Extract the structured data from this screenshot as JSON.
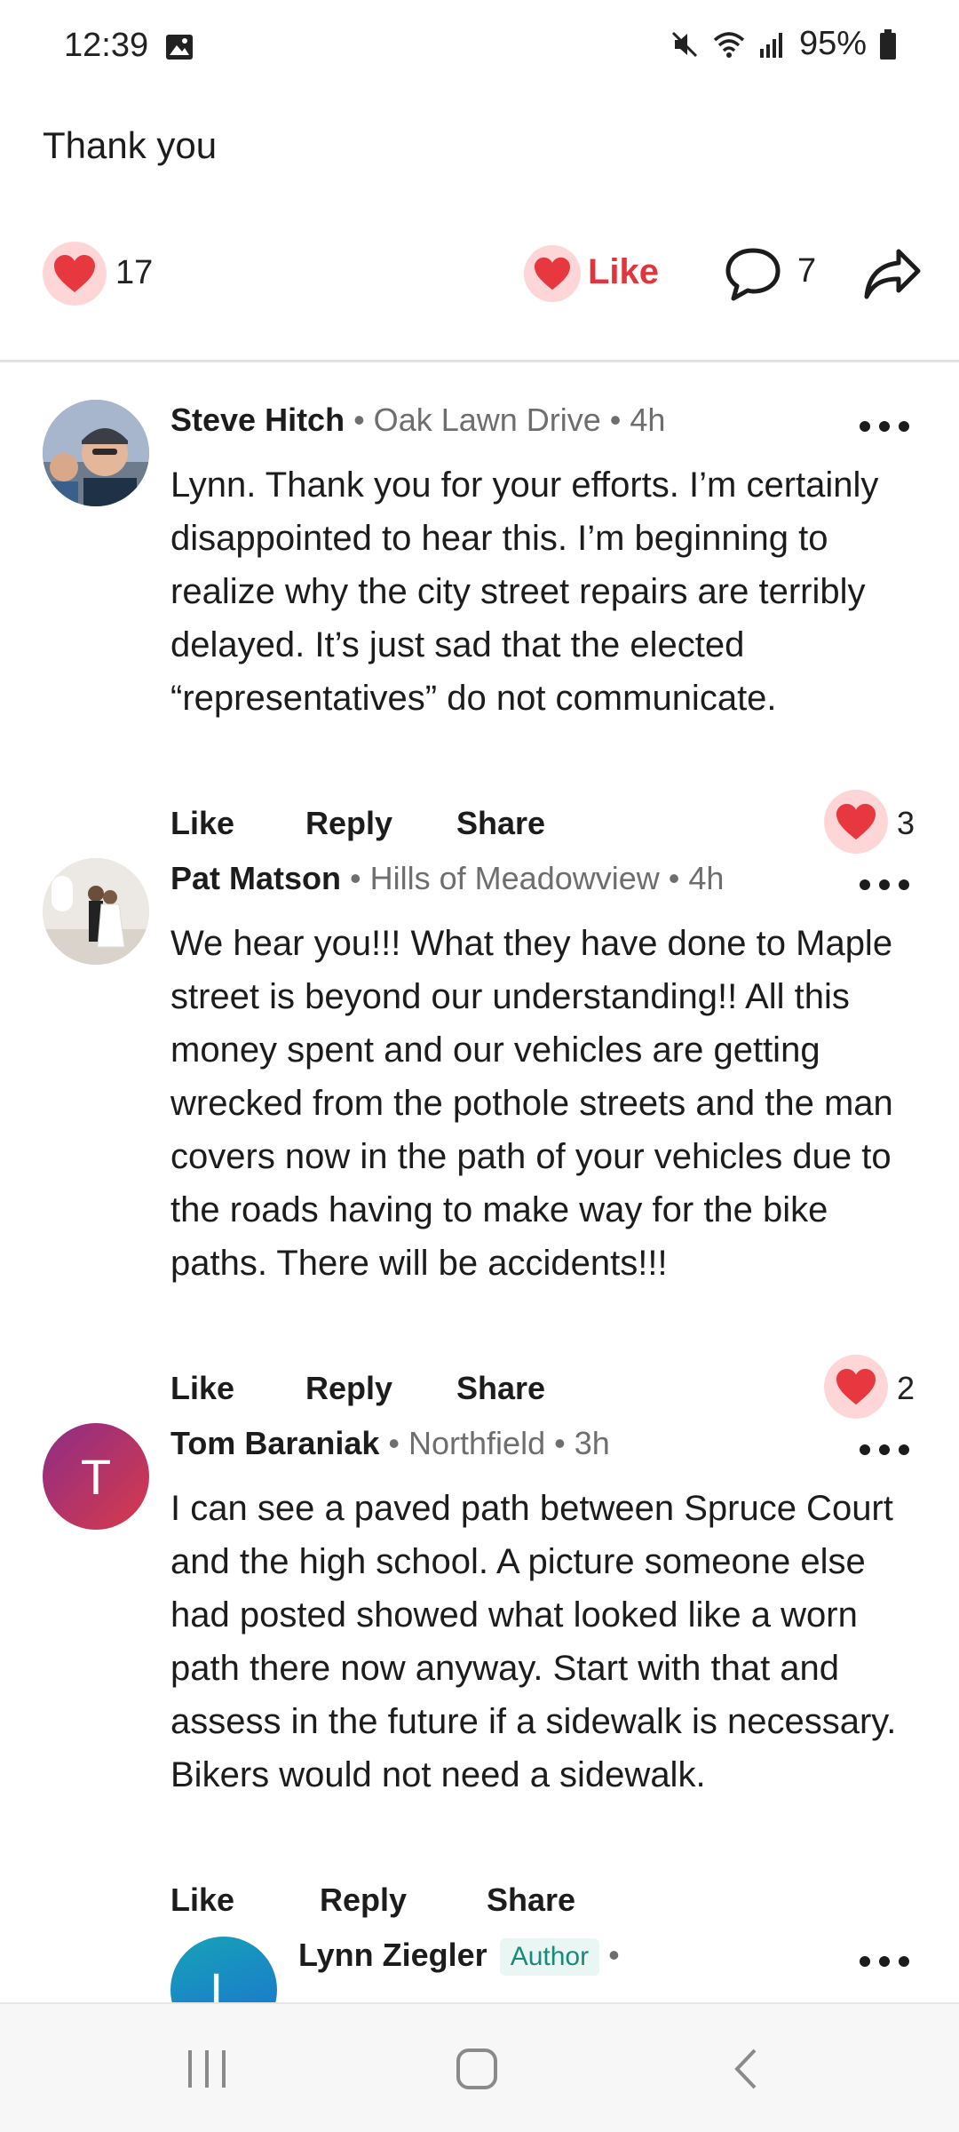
{
  "status_bar": {
    "time": "12:39",
    "battery": "95%"
  },
  "post": {
    "body": "Thank you",
    "reaction_count": "17",
    "like_label": "Like",
    "comment_count": "7"
  },
  "comments": [
    {
      "author": "Steve Hitch",
      "meta": " • Oak Lawn Drive • 4h",
      "text": "Lynn. Thank you for your efforts. I’m certainly disappointed to hear this. I’m beginning to realize why the city street repairs are terribly delayed. It’s just sad that the elected “representatives” do not communicate.",
      "like": "Like",
      "reply": "Reply",
      "share": "Share",
      "reaction_count": "3"
    },
    {
      "author": "Pat Matson",
      "meta": " • Hills of Meadowview • 4h",
      "text": "We hear you!!! What they have done to Maple street is beyond our understanding!! All this money spent and our vehicles are getting wrecked from the pothole streets and the man covers now in the path of your vehicles due to the roads having to make way for the bike paths. There will be accidents!!!",
      "like": "Like",
      "reply": "Reply",
      "share": "Share",
      "reaction_count": "2"
    },
    {
      "author": "Tom Baraniak",
      "meta": " • Northfield • 3h",
      "avatar_letter": "T",
      "text": "I can see a paved path between Spruce Court and the high school. A picture someone else had posted showed what looked like a worn path there now anyway. Start with that and assess in the future if a sidewalk is necessary. Bikers would not need a sidewalk.",
      "like": "Like",
      "reply": "Reply",
      "share": "Share"
    }
  ],
  "reply_preview": {
    "author": "Lynn Ziegler",
    "badge": "Author",
    "meta": " •",
    "avatar_letter": "L"
  },
  "colors": {
    "like_red": "#e0353c",
    "heart_bg": "#ffd6d8",
    "author_badge": "#1a8a78",
    "avatar_t": "#b8275f",
    "avatar_l": "#1b8fc4"
  },
  "icons": [
    "image-icon",
    "mute-icon",
    "wifi-icon",
    "signal-icon",
    "battery-icon",
    "heart-icon",
    "comment-icon",
    "share-icon",
    "more-icon",
    "recents-icon",
    "home-icon",
    "back-icon"
  ]
}
